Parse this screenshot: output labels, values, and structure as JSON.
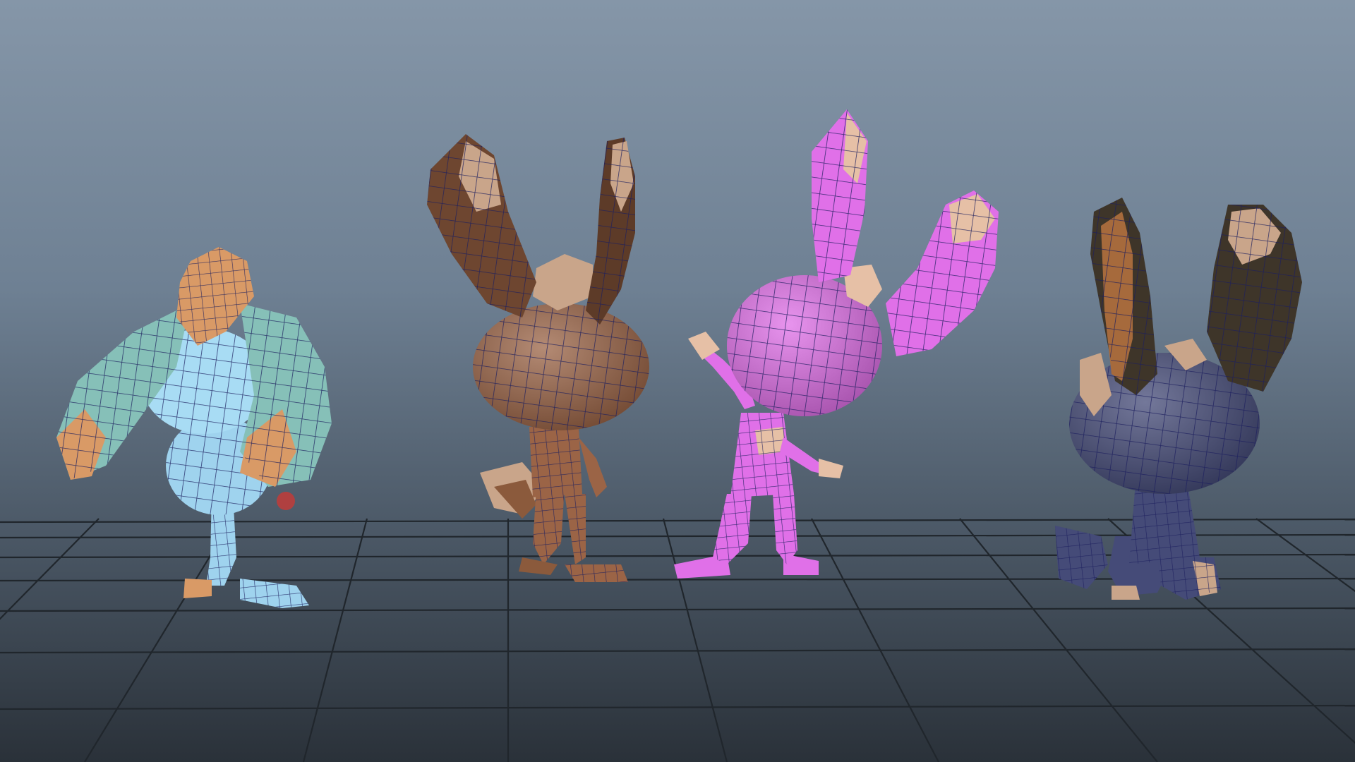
{
  "viewport": {
    "background_top": "#8596a8",
    "background_bottom": "#2a3139",
    "grid_color": "#1f252b",
    "wire_color": "#1c1f5e"
  },
  "characters": [
    {
      "id": "teal-rabbit",
      "body_color": "#9fd3ee",
      "ear_color": "#86c0b8",
      "accent_color": "#d99a66",
      "view": "back"
    },
    {
      "id": "brown-rabbit",
      "body_color": "#9b6446",
      "ear_color": "#6e4630",
      "accent_color": "#c9a58a",
      "view": "back"
    },
    {
      "id": "magenta-rabbit",
      "body_color": "#e070e8",
      "ear_color": "#e070e8",
      "accent_color": "#e6c0a6",
      "view": "front-waving"
    },
    {
      "id": "navy-rabbit",
      "body_color": "#454b78",
      "ear_color": "#3e3529",
      "accent_color": "#c9a58a",
      "view": "sitting"
    }
  ]
}
